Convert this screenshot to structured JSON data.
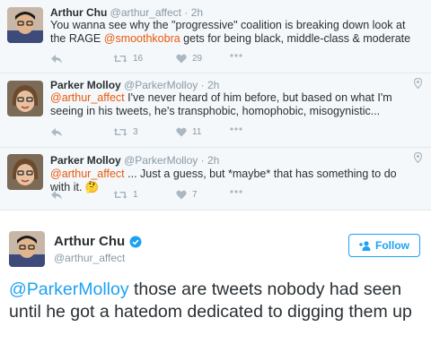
{
  "replies": [
    {
      "name": "Arthur Chu",
      "handle": "@arthur_affect",
      "dot": "·",
      "time": "2h",
      "text_parts": [
        "You wanna see why the \"progressive\" coalition is breaking down look at the RAGE ",
        "@smoothkobra",
        " gets for being black, middle-class & moderate"
      ],
      "retweets": "16",
      "likes": "29",
      "has_pin": false
    },
    {
      "name": "Parker Molloy",
      "handle": "@ParkerMolloy",
      "dot": "·",
      "time": "2h",
      "text_parts": [
        "@arthur_affect",
        " I've never heard of him before, but based on what I'm seeing in his tweets, he's transphobic, homophobic, misogynistic..."
      ],
      "retweets": "3",
      "likes": "11",
      "has_pin": true
    },
    {
      "name": "Parker Molloy",
      "handle": "@ParkerMolloy",
      "dot": "·",
      "time": "2h",
      "text_parts": [
        "@arthur_affect",
        " ... Just a guess, but *maybe* that has something to do with it. 🤔"
      ],
      "retweets": "1",
      "likes": "7",
      "has_pin": true
    }
  ],
  "main_tweet": {
    "name": "Arthur Chu",
    "handle": "@arthur_affect",
    "verified": true,
    "follow_label": "Follow",
    "text_parts": [
      "@ParkerMolloy",
      " those are tweets nobody had seen until he got a hatedom dedicated to digging them up"
    ]
  },
  "icons": {
    "reply": "reply-arrow-icon",
    "retweet": "retweet-icon",
    "like": "heart-icon",
    "more": "more-dots-icon",
    "pin": "location-pin-icon",
    "verified": "verified-badge-icon",
    "follow": "add-person-icon"
  },
  "colors": {
    "mention_reply": "#e8590c",
    "mention_main": "#1da1f2",
    "muted": "#8899a6",
    "verified": "#1da1f2",
    "background_replies": "#f5f8fa"
  }
}
